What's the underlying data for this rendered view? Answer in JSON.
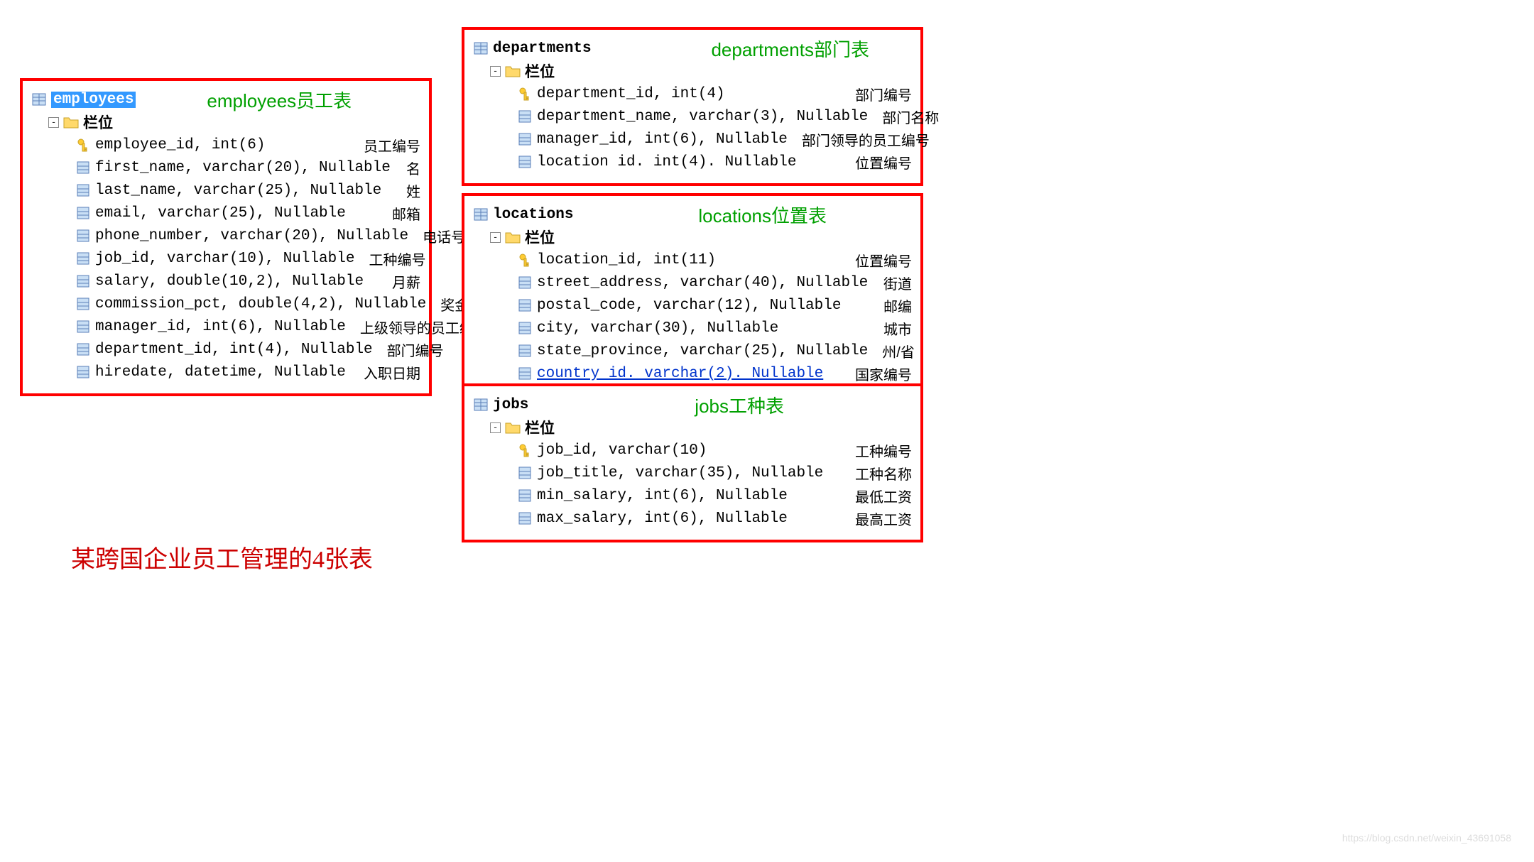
{
  "caption": "某跨国企业员工管理的4张表",
  "watermark": "https://blog.csdn.net/weixin_43691058",
  "folder_label": "栏位",
  "toggle_symbol": "-",
  "titles": {
    "employees": "employees员工表",
    "departments": "departments部门表",
    "locations": "locations位置表",
    "jobs": "jobs工种表"
  },
  "tables": {
    "employees": {
      "name": "employees",
      "selected": true,
      "fields": [
        {
          "pk": true,
          "def": "employee_id, int(6)",
          "desc": "员工编号"
        },
        {
          "pk": false,
          "def": "first_name, varchar(20), Nullable",
          "desc": "名"
        },
        {
          "pk": false,
          "def": "last_name, varchar(25), Nullable",
          "desc": "姓"
        },
        {
          "pk": false,
          "def": "email, varchar(25), Nullable",
          "desc": "邮箱"
        },
        {
          "pk": false,
          "def": "phone_number, varchar(20), Nullable",
          "desc": "电话号码"
        },
        {
          "pk": false,
          "def": "job_id, varchar(10), Nullable",
          "desc": "工种编号"
        },
        {
          "pk": false,
          "def": "salary, double(10,2), Nullable",
          "desc": "月薪"
        },
        {
          "pk": false,
          "def": "commission_pct, double(4,2), Nullable",
          "desc": "奖金率"
        },
        {
          "pk": false,
          "def": "manager_id, int(6), Nullable",
          "desc": "上级领导的员工编号"
        },
        {
          "pk": false,
          "def": "department_id, int(4), Nullable",
          "desc": "部门编号"
        },
        {
          "pk": false,
          "def": "hiredate, datetime, Nullable",
          "desc": "入职日期"
        }
      ]
    },
    "departments": {
      "name": "departments",
      "selected": false,
      "fields": [
        {
          "pk": true,
          "def": "department_id, int(4)",
          "desc": "部门编号"
        },
        {
          "pk": false,
          "def": "department_name, varchar(3), Nullable",
          "desc": "部门名称"
        },
        {
          "pk": false,
          "def": "manager_id, int(6), Nullable",
          "desc": "部门领导的员工编号"
        },
        {
          "pk": false,
          "def": "location id. int(4). Nullable",
          "desc": "位置编号"
        }
      ]
    },
    "locations": {
      "name": "locations",
      "selected": false,
      "fields": [
        {
          "pk": true,
          "def": "location_id, int(11)",
          "desc": "位置编号"
        },
        {
          "pk": false,
          "def": "street_address, varchar(40), Nullable",
          "desc": "街道"
        },
        {
          "pk": false,
          "def": "postal_code, varchar(12), Nullable",
          "desc": "邮编"
        },
        {
          "pk": false,
          "def": "city, varchar(30), Nullable",
          "desc": "城市"
        },
        {
          "pk": false,
          "def": "state_province, varchar(25), Nullable",
          "desc": "州/省"
        },
        {
          "pk": false,
          "def": "country id. varchar(2). Nullable",
          "desc": "国家编号",
          "link": true
        }
      ]
    },
    "jobs": {
      "name": "jobs",
      "selected": false,
      "fields": [
        {
          "pk": true,
          "def": "job_id, varchar(10)",
          "desc": "工种编号"
        },
        {
          "pk": false,
          "def": "job_title, varchar(35), Nullable",
          "desc": "工种名称"
        },
        {
          "pk": false,
          "def": "min_salary, int(6), Nullable",
          "desc": "最低工资"
        },
        {
          "pk": false,
          "def": "max_salary, int(6), Nullable",
          "desc": "最高工资"
        }
      ]
    }
  }
}
